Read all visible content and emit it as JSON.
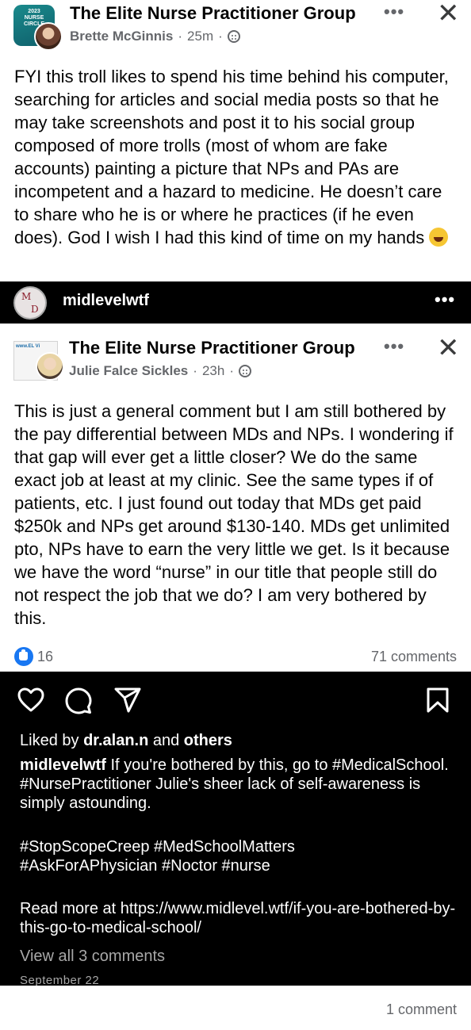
{
  "outer_post": {
    "group_name": "The Elite Nurse Practitioner Group",
    "author": "Brette McGinnis",
    "time": "25m",
    "thumb_text": "2023 NURSE CIRCLE",
    "body": "FYI this troll likes to spend his time behind his computer, searching for articles and social media posts so that he may take screenshots and post it to his social group composed of more trolls (most of whom are fake accounts) painting a picture that NPs and PAs are incompetent and a hazard to medicine. He doesn’t care to share who he is or where he practices (if he even does). God I wish I had this kind of time on my hands",
    "emoji": "rolling-on-floor-laughing",
    "more_label": "•••",
    "close_label": "✕"
  },
  "instagram_header": {
    "handle": "midlevelwtf",
    "avatar_letters": [
      "M",
      "D"
    ],
    "more_label": "•••"
  },
  "inner_post": {
    "group_name": "The Elite Nurse Practitioner Group",
    "author": "Julie Falce Sickles",
    "time": "23h",
    "thumb_text": "www.EL Vi",
    "body": "This is just a general comment but I am still bothered by the pay differential between MDs and NPs. I wondering if that gap will ever get a little closer?  We do the same exact job at least at my clinic. See the same types if of patients, etc. I just found out today that MDs get paid $250k and NPs get around $130-140. MDs get unlimited pto, NPs have to earn the very little we get. Is it because we have the word “nurse” in our title that people still do not respect the job that we do?  I am very bothered by this.",
    "likes": "16",
    "comments": "71 comments",
    "more_label": "•••",
    "close_label": "✕"
  },
  "instagram_footer": {
    "liked_by_prefix": "Liked by ",
    "liked_by_user": "dr.alan.n",
    "liked_by_and": " and ",
    "liked_by_others": "others",
    "caption_user": "midlevelwtf",
    "caption_text": " If you're bothered by this, go to #MedicalSchool. #NursePractitioner Julie's sheer lack of self-awareness is simply astounding.",
    "hashtags_line1": "#StopScopeCreep #MedSchoolMatters",
    "hashtags_line2": "#AskForAPhysician #Noctor #nurse",
    "read_more": "Read more at https://www.midlevel.wtf/if-you-are-bothered-by-this-go-to-medical-school/",
    "view_all": "View all 3 comments",
    "date": "September 22"
  },
  "footer": {
    "comment_count": "1 comment"
  },
  "colors": {
    "text": "#050505",
    "meta": "#65676b",
    "like_blue": "#1877f2",
    "ig_bg": "#000000",
    "ig_muted": "#a8a8a8"
  }
}
